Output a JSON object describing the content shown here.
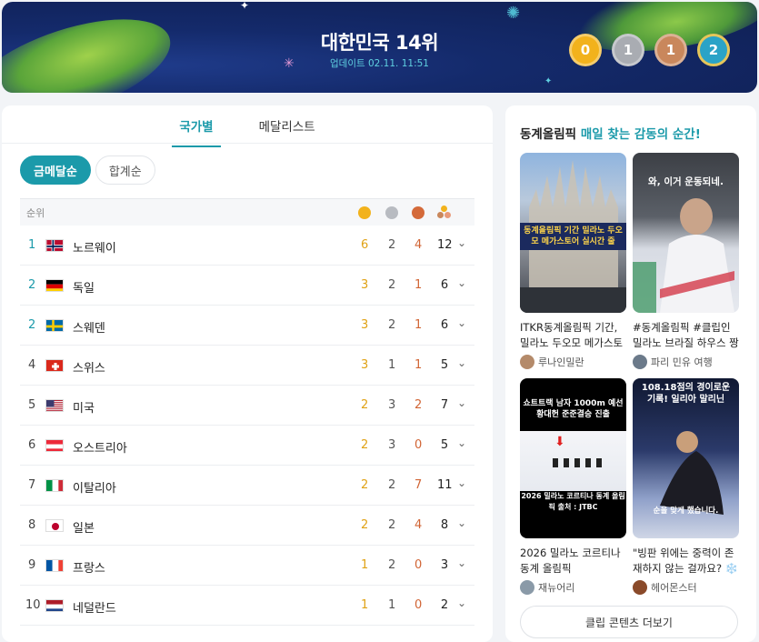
{
  "banner": {
    "title": "대한민국 14위",
    "update": "업데이트 02.11. 11:51",
    "medals": {
      "gold": "0",
      "silver": "1",
      "bronze": "1",
      "total": "2"
    }
  },
  "tabs": [
    {
      "label": "국가별"
    },
    {
      "label": "메달리스트"
    }
  ],
  "sort": [
    {
      "label": "금메달순"
    },
    {
      "label": "합계순"
    }
  ],
  "table": {
    "rank_header": "순위",
    "rows": [
      {
        "rank": "1",
        "country": "노르웨이",
        "gold": "6",
        "silver": "2",
        "bronze": "4",
        "total": "12"
      },
      {
        "rank": "2",
        "country": "독일",
        "gold": "3",
        "silver": "2",
        "bronze": "1",
        "total": "6"
      },
      {
        "rank": "2",
        "country": "스웨덴",
        "gold": "3",
        "silver": "2",
        "bronze": "1",
        "total": "6"
      },
      {
        "rank": "4",
        "country": "스위스",
        "gold": "3",
        "silver": "1",
        "bronze": "1",
        "total": "5"
      },
      {
        "rank": "5",
        "country": "미국",
        "gold": "2",
        "silver": "3",
        "bronze": "2",
        "total": "7"
      },
      {
        "rank": "6",
        "country": "오스트리아",
        "gold": "2",
        "silver": "3",
        "bronze": "0",
        "total": "5"
      },
      {
        "rank": "7",
        "country": "이탈리아",
        "gold": "2",
        "silver": "2",
        "bronze": "7",
        "total": "11"
      },
      {
        "rank": "8",
        "country": "일본",
        "gold": "2",
        "silver": "2",
        "bronze": "4",
        "total": "8"
      },
      {
        "rank": "9",
        "country": "프랑스",
        "gold": "1",
        "silver": "2",
        "bronze": "0",
        "total": "3"
      },
      {
        "rank": "10",
        "country": "네덜란드",
        "gold": "1",
        "silver": "1",
        "bronze": "0",
        "total": "2"
      }
    ]
  },
  "clips": {
    "title_prefix": "동계올림픽",
    "title_highlight": "매일 찾는 감동의 순간!",
    "items": [
      {
        "caption": "ITKR동계올림픽 기간, 밀라노 두오모 메가스토어 실시간 줄",
        "author": "루나인밀란",
        "overlay": "동계올림픽 기간 밀라노 두오모 메가스토어 실시간 줄"
      },
      {
        "caption": "#동계올림픽 #클립인밀라노 브라질 하우스 짱",
        "author": "파리 민유 여행",
        "overlay": "와, 이거 운동되네."
      },
      {
        "caption": "2026 밀라노 코르티나 동계 올림픽",
        "author": "재뉴어리",
        "overlay": "쇼트트랙 남자 1000m 예선 황대헌 준준결승 진출",
        "overlay2": "2026 밀라노 코르티나 동계 올림픽 출처 : JTBC"
      },
      {
        "caption": "\"빙판 위에는 중력이 존재하지 않는 걸까요? ❄️",
        "author": "헤어몬스터",
        "overlay": "108.18점의 경이로운 기록! 일리아 말리닌",
        "overlay2": "순을 맞게 했습니다."
      }
    ],
    "more_label": "클립 콘텐츠 더보기"
  }
}
